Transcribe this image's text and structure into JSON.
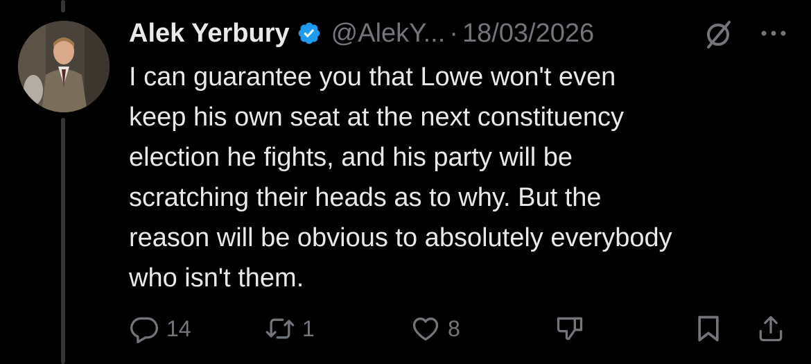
{
  "tweet": {
    "author": {
      "display_name": "Alek Yerbury",
      "verified": true,
      "handle": "@AlekY...",
      "avatar": "avatar-photo"
    },
    "separator": "·",
    "date": "18/03/2026",
    "text_lines": [
      "I can guarantee you that Lowe won't even",
      "keep his own seat at the next constituency",
      "election he fights, and his party will be",
      "scratching their heads as to why. But the",
      "reason will be obvious to absolutely everybody",
      "who isn't them."
    ],
    "header_icons": [
      "grok-icon",
      "more-options-icon"
    ],
    "actions": {
      "reply": {
        "icon": "reply-icon",
        "count": "14"
      },
      "repost": {
        "icon": "repost-icon",
        "count": "1"
      },
      "like": {
        "icon": "heart-icon",
        "count": "8"
      },
      "dislike": {
        "icon": "thumbs-down-icon"
      },
      "bookmark": {
        "icon": "bookmark-icon"
      },
      "share": {
        "icon": "share-icon"
      }
    }
  },
  "colors": {
    "background": "#000000",
    "primary_text": "#e7e9ea",
    "secondary_text": "#71767b",
    "verified_badge": "#1d9bf0",
    "thread_line": "#333639"
  }
}
